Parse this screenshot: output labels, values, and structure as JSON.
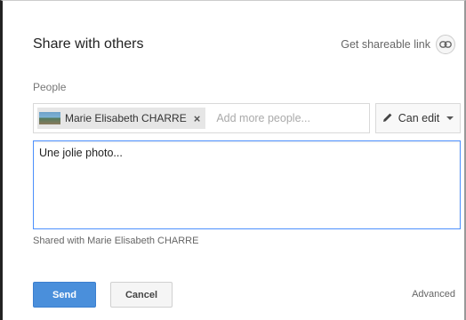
{
  "dialog": {
    "title": "Share with others",
    "share_link_label": "Get shareable link",
    "share_link_icon": "link-icon"
  },
  "people": {
    "label": "People",
    "chips": [
      {
        "name": "Marie Elisabeth CHARRE",
        "remove": "×",
        "thumb_icon": "photo-thumbnail-icon"
      }
    ],
    "placeholder": "Add more people..."
  },
  "permission": {
    "label": "Can edit",
    "icon": "pencil-icon",
    "caret_icon": "caret-down-icon"
  },
  "message": {
    "value": "Une jolie photo..."
  },
  "shared_with": "Shared with Marie Elisabeth CHARRE",
  "footer": {
    "send_label": "Send",
    "cancel_label": "Cancel",
    "advanced_label": "Advanced",
    "send_color": "#4a8fdb"
  }
}
